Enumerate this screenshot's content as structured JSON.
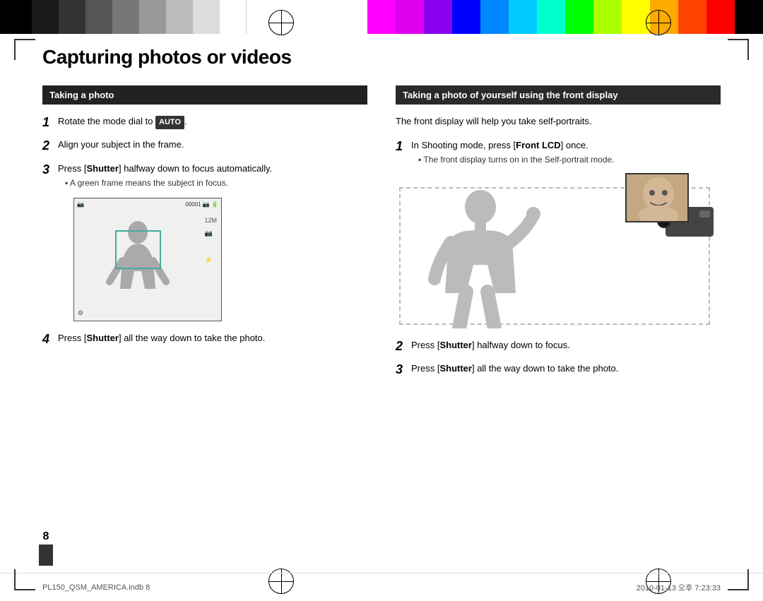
{
  "page": {
    "title": "Capturing photos or videos",
    "number": "8",
    "footer_left": "PL150_QSM_AMERICA.indb   8",
    "footer_right": "2010-01-13   오후 7:23:33"
  },
  "left_section": {
    "header": "Taking a photo",
    "steps": [
      {
        "number": "1",
        "text_before": "Rotate the mode dial to ",
        "badge": "AUTO",
        "text_after": "."
      },
      {
        "number": "2",
        "text": "Align your subject in the frame."
      },
      {
        "number": "3",
        "text_before": "Press [",
        "bold": "Shutter",
        "text_after": "] halfway down to focus automatically.",
        "sub_bullet": "A green frame means the subject in focus."
      },
      {
        "number": "4",
        "text_before": "Press [",
        "bold": "Shutter",
        "text_after": "] all the way down to take the photo."
      }
    ]
  },
  "right_section": {
    "header": "Taking a photo of yourself using the front display",
    "intro": "The front display will help you take self-portraits.",
    "steps": [
      {
        "number": "1",
        "text_before": "In Shooting mode, press [",
        "bold": "Front LCD",
        "text_after": "] once.",
        "sub_bullet": "The front display turns on in the Self-portrait mode."
      },
      {
        "number": "2",
        "text_before": "Press [",
        "bold": "Shutter",
        "text_after": "] halfway down to focus."
      },
      {
        "number": "3",
        "text_before": "Press [",
        "bold": "Shutter",
        "text_after": "] all the way down to take the photo."
      }
    ]
  },
  "colors": {
    "grayscale": [
      "#000000",
      "#1a1a1a",
      "#333333",
      "#555555",
      "#777777",
      "#999999",
      "#bbbbbb",
      "#dddddd",
      "#ffffff"
    ],
    "color_swatches": [
      "#ff00ff",
      "#ff00aa",
      "#aa00ff",
      "#0000ff",
      "#00aaff",
      "#00ffff",
      "#00ff00",
      "#aaff00",
      "#ffff00",
      "#ffaa00",
      "#ff5500",
      "#ff0000",
      "#000000"
    ],
    "accent": "#2a2a2a"
  }
}
